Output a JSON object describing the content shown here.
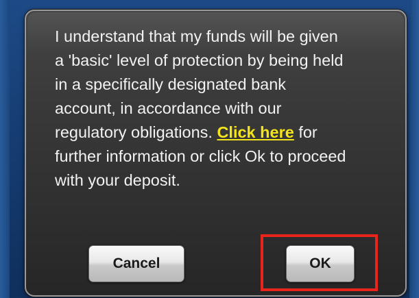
{
  "dialog": {
    "message_before_link": "I understand that my funds will be given a 'basic' level of protection by being held in a specifically designated bank account, in accordance with our regulatory obligations. ",
    "link_text": "Click here",
    "message_after_link": " for further information or click Ok to proceed with your deposit.",
    "buttons": {
      "cancel_label": "Cancel",
      "ok_label": "OK"
    }
  },
  "colors": {
    "background": "#163d73",
    "dialog": "#333333",
    "link": "#f5e41a",
    "highlight": "#e8251c"
  }
}
